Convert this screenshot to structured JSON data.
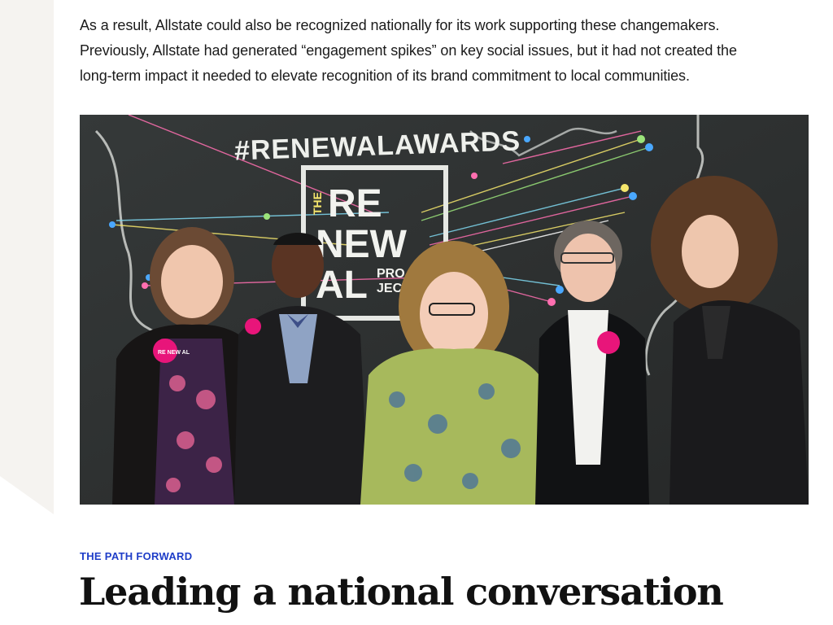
{
  "article": {
    "intro_paragraph": "As a result, Allstate could also be recognized nationally for its work supporting these changemakers. Previously, Allstate had generated “engagement spikes” on key social issues, but it had not created the long-term impact it needed to elevate recognition of its brand commitment to local communities.",
    "intro_lines": [
      "As a result, Allstate could also be recognized nationally for its work supporting these changemakers.",
      "Previously, Allstate had generated “engagement spikes” on key social issues, but it had not created the",
      "long-term impact it needed to elevate recognition of its brand commitment to local communities."
    ],
    "photo": {
      "wall_hashtag": "#RENEWALAWARDS",
      "logo_text": [
        "THE",
        "RE",
        "NEW",
        "AL",
        "PRO",
        "JECT"
      ],
      "badge_text": "RE NEW AL"
    },
    "section_eyebrow": "THE PATH FORWARD",
    "section_heading": "Leading a national conversation"
  },
  "colors": {
    "eyebrow": "#1e3dc8",
    "heading": "#111111",
    "body_text": "#1b1b1b",
    "side_band": "#f5f3f0",
    "chalkboard": "#2b2e2e",
    "badge_pink": "#e8157a"
  }
}
